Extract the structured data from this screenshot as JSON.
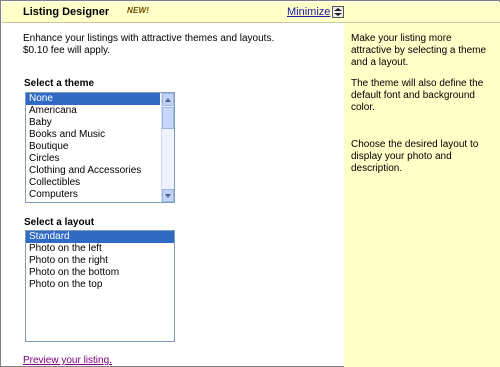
{
  "header": {
    "title": "Listing Designer",
    "new_badge": "NEW!",
    "minimize_label": "Minimize"
  },
  "main": {
    "intro_line1": "Enhance your listings with attractive themes and layouts.",
    "intro_line2": "$0.10 fee will apply.",
    "theme_label": "Select a theme",
    "themes": [
      "None",
      "Americana",
      "Baby",
      "Books and Music",
      "Boutique",
      "Circles",
      "Clothing and Accessories",
      "Collectibles",
      "Computers"
    ],
    "selected_theme": "None",
    "layout_label": "Select a layout",
    "layouts": [
      "Standard",
      "Photo on the left",
      "Photo on the right",
      "Photo on the bottom",
      "Photo on the top"
    ],
    "selected_layout": "Standard",
    "preview_link": "Preview your listing."
  },
  "side_panel": {
    "hint1_line1": "Make your listing more",
    "hint1_line2": "attractive by selecting a theme",
    "hint1_line3": "and a layout.",
    "hint2_line1": "The theme will also define the",
    "hint2_line2": "default font and background",
    "hint2_line3": "color.",
    "hint3_line1": "Choose the desired layout to",
    "hint3_line2": "display your photo and",
    "hint3_line3": "description."
  },
  "colors": {
    "panel_bg": "#ffffc8",
    "selection": "#316ac5",
    "link": "#1a1aa6",
    "visited_link": "#800080"
  }
}
